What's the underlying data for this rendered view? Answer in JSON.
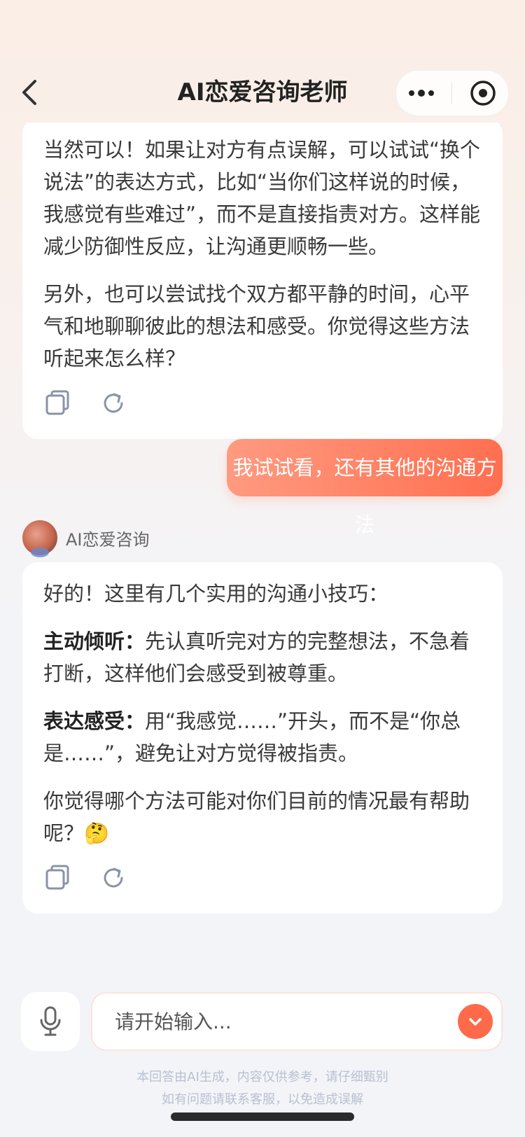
{
  "header": {
    "title": "AI恋爱咨询老师"
  },
  "messages": {
    "ai_1": {
      "paragraphs": [
        "当然可以！如果让对方有点误解，可以试试“换个说法”的表达方式，比如“当你们这样说的时候，我感觉有些难过”，而不是直接指责对方。这样能减少防御性反应，让沟通更顺畅一些。",
        "另外，也可以尝试找个双方都平静的时间，心平气和地聊聊彼此的想法和感受。你觉得这些方法听起来怎么样？"
      ]
    },
    "user_1": {
      "text": "我试试看，还有其他的沟通方法"
    },
    "assistant": {
      "name": "AI恋爱咨询"
    },
    "ai_2": {
      "p1": "好的！这里有几个实用的沟通小技巧：",
      "p2_bold": "主动倾听：",
      "p2_text": "先认真听完对方的完整想法，不急着打断，这样他们会感受到被尊重。",
      "p3_bold": "表达感受：",
      "p3_text": "用“我感觉……”开头，而不是“你总是……”，避免让对方觉得被指责。",
      "p4_text": "你觉得哪个方法可能对你们目前的情况最有帮助呢？",
      "p4_emoji": "🤔"
    }
  },
  "input": {
    "placeholder": "请开始输入..."
  },
  "disclaimer": {
    "line1": "本回答由AI生成，内容仅供参考，请仔细甄别",
    "line2": "如有问题请联系客服，以免造成误解"
  },
  "colors": {
    "accent": "#ff6a4a",
    "user_bubble_start": "#ff9a80",
    "user_bubble_end": "#ff6f50"
  },
  "icons": {
    "back": "chevron-left-icon",
    "more": "more-dots-icon",
    "close": "target-close-icon",
    "copy": "copy-icon",
    "refresh": "refresh-icon",
    "mic": "microphone-icon",
    "send": "send-icon"
  }
}
